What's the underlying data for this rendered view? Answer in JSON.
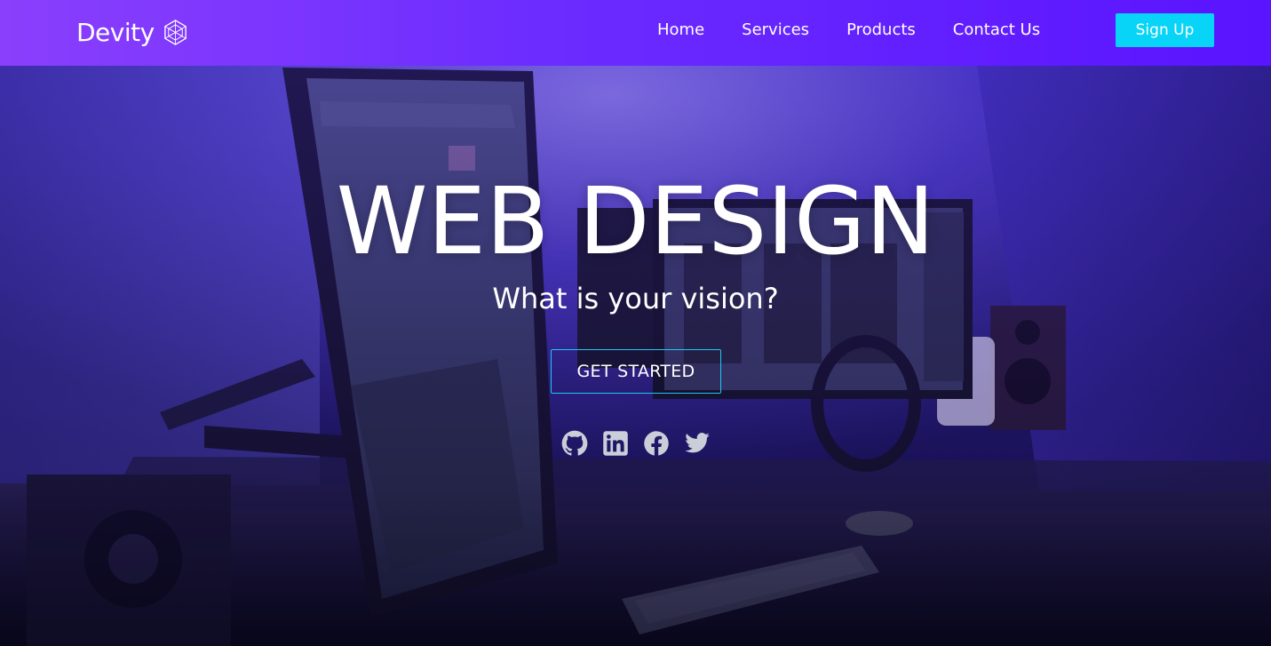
{
  "brand": {
    "name": "Devity",
    "logo_icon": "hexagon-mesh-icon"
  },
  "nav": {
    "links": [
      {
        "label": "Home"
      },
      {
        "label": "Services"
      },
      {
        "label": "Products"
      },
      {
        "label": "Contact Us"
      }
    ],
    "signup_label": "Sign Up"
  },
  "hero": {
    "title": "WEB DESIGN",
    "subtitle": "What is your vision?",
    "cta_label": "GET STARTED",
    "social_icons": [
      "github-icon",
      "linkedin-icon",
      "facebook-icon",
      "twitter-icon"
    ]
  },
  "colors": {
    "header_gradient_start": "#8a3ffc",
    "header_gradient_end": "#5a14ff",
    "accent_cyan": "#08d4f7",
    "text": "#ffffff",
    "social_icon": "#c9ced8"
  }
}
